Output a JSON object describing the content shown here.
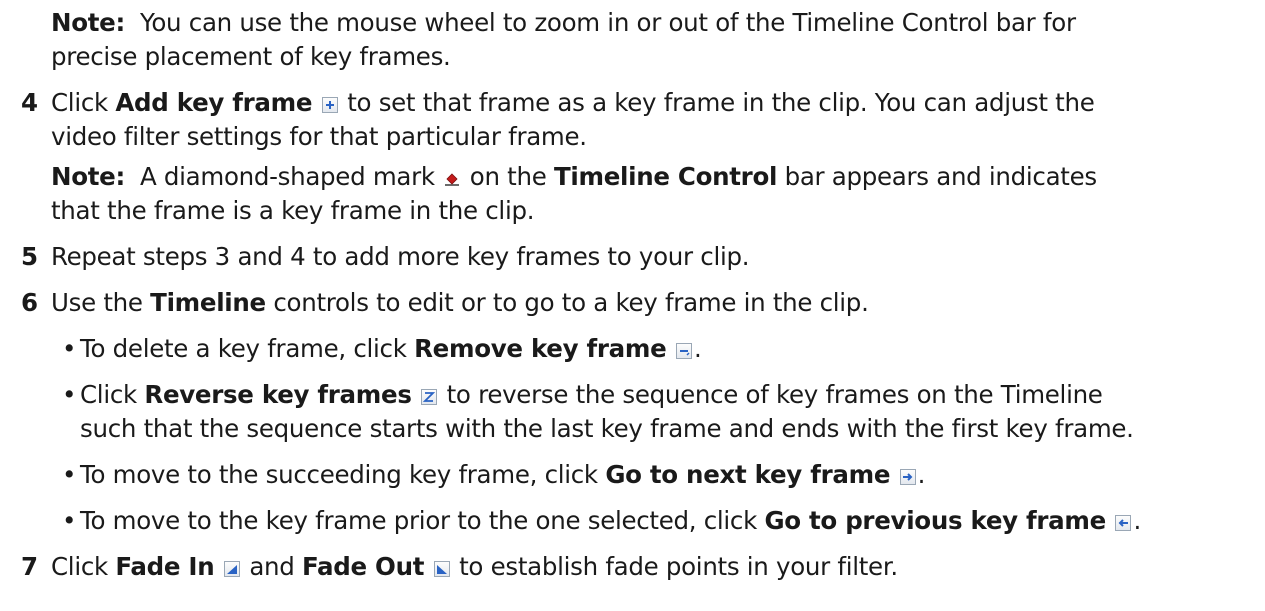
{
  "note1": {
    "label": "Note:",
    "text": "You can use the mouse wheel to zoom in or out of the Timeline Control bar for",
    "text_cont": "precise placement of key frames."
  },
  "step4": {
    "num": "4",
    "t1": "Click ",
    "b1": "Add key frame",
    "t2": " to set that frame as a key frame in the clip. You can adjust the",
    "cont": "video filter settings for that particular frame.",
    "note_label": "Note:",
    "note_t1": "A diamond-shaped mark",
    "note_t2": " on the ",
    "note_b1": "Timeline Control",
    "note_t3": " bar appears and indicates",
    "note_cont": "that the frame is a key frame in the clip."
  },
  "step5": {
    "num": "5",
    "text": "Repeat steps 3 and 4 to add more key frames to your clip."
  },
  "step6": {
    "num": "6",
    "t1": "Use the ",
    "b1": "Timeline",
    "t2": " controls to edit or to go to a key frame in the clip.",
    "bullets": [
      {
        "t1": "To delete a key frame, click ",
        "b1": "Remove key frame",
        "t2": "."
      },
      {
        "t1": "Click ",
        "b1": "Reverse key frames",
        "t2": " to reverse the sequence of key frames on the Timeline",
        "cont": "such that the sequence starts with the last key frame and ends with the first key frame."
      },
      {
        "t1": "To move to the succeeding key frame, click ",
        "b1": "Go to next key frame",
        "t2": "."
      },
      {
        "t1": "To move to the key frame prior to the one selected, click ",
        "b1": "Go to previous key frame",
        "t2": "."
      }
    ]
  },
  "step7": {
    "num": "7",
    "t1": "Click ",
    "b1": "Fade In",
    "t2": " and ",
    "b2": "Fade Out",
    "t3": " to establish fade points in your filter."
  },
  "icons": {
    "add": "add-key-frame-icon",
    "diamond": "diamond-mark-icon",
    "remove": "remove-key-frame-icon",
    "reverse": "reverse-key-frames-icon",
    "next": "next-key-frame-icon",
    "prev": "previous-key-frame-icon",
    "fade_in": "fade-in-icon",
    "fade_out": "fade-out-icon"
  },
  "colors": {
    "text": "#1a1a1a",
    "icon_blue": "#2a63c4",
    "diamond_red": "#c41b1b"
  }
}
